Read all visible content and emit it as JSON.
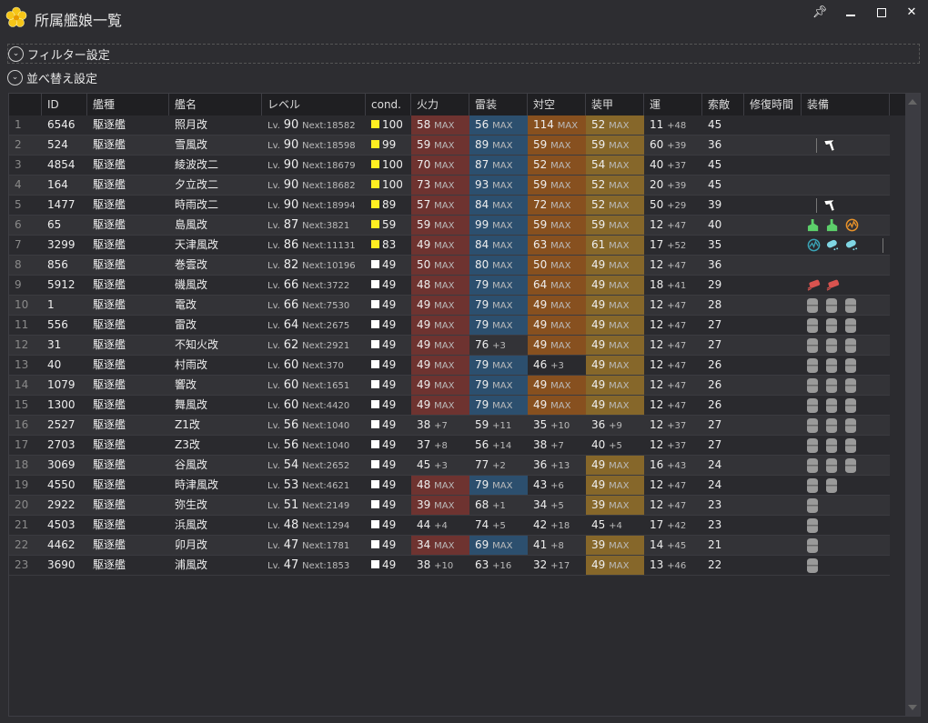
{
  "window": {
    "title": "所属艦娘一覧",
    "pin": "pin-icon",
    "minimize": "minimize-icon",
    "maximize": "maximize-icon",
    "close": "close-icon"
  },
  "filter_label": "フィルター設定",
  "sort_label": "並べ替え設定",
  "columns": [
    "",
    "ID",
    "艦種",
    "艦名",
    "レベル",
    "cond.",
    "火力",
    "雷装",
    "対空",
    "装甲",
    "運",
    "索敵",
    "修復時間",
    "装備"
  ],
  "colors": {
    "fire": "#6e3330",
    "torpedo": "#2c4f6e",
    "aa": "#87501f",
    "armor": "#86672a",
    "cond_high": "#ffee22",
    "cond_normal": "#ffffff"
  },
  "rows": [
    {
      "n": "1",
      "id": "6546",
      "type": "駆逐艦",
      "name": "照月改",
      "lv": "90",
      "next": "Next:18582",
      "cond": "100",
      "fire": [
        "58",
        "MAX"
      ],
      "torp": [
        "56",
        "MAX"
      ],
      "aa": [
        "114",
        "MAX"
      ],
      "arm": [
        "52",
        "MAX"
      ],
      "luck": [
        "11",
        "+48"
      ],
      "los": "45",
      "eq": []
    },
    {
      "n": "2",
      "id": "524",
      "type": "駆逐艦",
      "name": "雪風改",
      "lv": "90",
      "next": "Next:18598",
      "cond": "99",
      "fire": [
        "59",
        "MAX"
      ],
      "torp": [
        "89",
        "MAX"
      ],
      "aa": [
        "59",
        "MAX"
      ],
      "arm": [
        "59",
        "MAX"
      ],
      "luck": [
        "60",
        "+39"
      ],
      "los": "36",
      "eq": [
        "divider",
        "aircraft"
      ]
    },
    {
      "n": "3",
      "id": "4854",
      "type": "駆逐艦",
      "name": "綾波改二",
      "lv": "90",
      "next": "Next:18679",
      "cond": "100",
      "fire": [
        "70",
        "MAX"
      ],
      "torp": [
        "87",
        "MAX"
      ],
      "aa": [
        "52",
        "MAX"
      ],
      "arm": [
        "54",
        "MAX"
      ],
      "luck": [
        "40",
        "+37"
      ],
      "los": "45",
      "eq": []
    },
    {
      "n": "4",
      "id": "164",
      "type": "駆逐艦",
      "name": "夕立改二",
      "lv": "90",
      "next": "Next:18682",
      "cond": "100",
      "fire": [
        "73",
        "MAX"
      ],
      "torp": [
        "93",
        "MAX"
      ],
      "aa": [
        "59",
        "MAX"
      ],
      "arm": [
        "52",
        "MAX"
      ],
      "luck": [
        "20",
        "+39"
      ],
      "los": "45",
      "eq": []
    },
    {
      "n": "5",
      "id": "1477",
      "type": "駆逐艦",
      "name": "時雨改二",
      "lv": "90",
      "next": "Next:18994",
      "cond": "89",
      "fire": [
        "57",
        "MAX"
      ],
      "torp": [
        "84",
        "MAX"
      ],
      "aa": [
        "72",
        "MAX"
      ],
      "arm": [
        "52",
        "MAX"
      ],
      "luck": [
        "50",
        "+29"
      ],
      "los": "39",
      "eq": [
        "divider",
        "aircraft"
      ]
    },
    {
      "n": "6",
      "id": "65",
      "type": "駆逐艦",
      "name": "島風改",
      "lv": "87",
      "next": "Next:3821",
      "cond": "59",
      "fire": [
        "59",
        "MAX"
      ],
      "torp": [
        "99",
        "MAX"
      ],
      "aa": [
        "59",
        "MAX"
      ],
      "arm": [
        "59",
        "MAX"
      ],
      "luck": [
        "12",
        "+47"
      ],
      "los": "40",
      "eq": [
        "gun",
        "gun",
        "radar-orange"
      ]
    },
    {
      "n": "7",
      "id": "3299",
      "type": "駆逐艦",
      "name": "天津風改",
      "lv": "86",
      "next": "Next:11131",
      "cond": "83",
      "fire": [
        "49",
        "MAX"
      ],
      "torp": [
        "84",
        "MAX"
      ],
      "aa": [
        "63",
        "MAX"
      ],
      "arm": [
        "61",
        "MAX"
      ],
      "luck": [
        "17",
        "+52"
      ],
      "los": "35",
      "eq": [
        "radar-teal",
        "depth-charge",
        "depth-charge",
        "divider"
      ]
    },
    {
      "n": "8",
      "id": "856",
      "type": "駆逐艦",
      "name": "巻雲改",
      "lv": "82",
      "next": "Next:10196",
      "cond": "49",
      "fire": [
        "50",
        "MAX"
      ],
      "torp": [
        "80",
        "MAX"
      ],
      "aa": [
        "50",
        "MAX"
      ],
      "arm": [
        "49",
        "MAX"
      ],
      "luck": [
        "12",
        "+47"
      ],
      "los": "36",
      "eq": []
    },
    {
      "n": "9",
      "id": "5912",
      "type": "駆逐艦",
      "name": "磯風改",
      "lv": "66",
      "next": "Next:3722",
      "cond": "49",
      "fire": [
        "48",
        "MAX"
      ],
      "torp": [
        "79",
        "MAX"
      ],
      "aa": [
        "64",
        "MAX"
      ],
      "arm": [
        "49",
        "MAX"
      ],
      "luck": [
        "18",
        "+41"
      ],
      "los": "29",
      "eq": [
        "torpedo",
        "torpedo"
      ]
    },
    {
      "n": "10",
      "id": "1",
      "type": "駆逐艦",
      "name": "電改",
      "lv": "66",
      "next": "Next:7530",
      "cond": "49",
      "fire": [
        "49",
        "MAX"
      ],
      "torp": [
        "79",
        "MAX"
      ],
      "aa": [
        "49",
        "MAX"
      ],
      "arm": [
        "49",
        "MAX"
      ],
      "luck": [
        "12",
        "+47"
      ],
      "los": "28",
      "eq": [
        "drum",
        "drum",
        "drum"
      ]
    },
    {
      "n": "11",
      "id": "556",
      "type": "駆逐艦",
      "name": "雷改",
      "lv": "64",
      "next": "Next:2675",
      "cond": "49",
      "fire": [
        "49",
        "MAX"
      ],
      "torp": [
        "79",
        "MAX"
      ],
      "aa": [
        "49",
        "MAX"
      ],
      "arm": [
        "49",
        "MAX"
      ],
      "luck": [
        "12",
        "+47"
      ],
      "los": "27",
      "eq": [
        "drum",
        "drum",
        "drum"
      ]
    },
    {
      "n": "12",
      "id": "31",
      "type": "駆逐艦",
      "name": "不知火改",
      "lv": "62",
      "next": "Next:2921",
      "cond": "49",
      "fire": [
        "49",
        "MAX"
      ],
      "torp": [
        "76",
        "+3"
      ],
      "aa": [
        "49",
        "MAX"
      ],
      "arm": [
        "49",
        "MAX"
      ],
      "luck": [
        "12",
        "+47"
      ],
      "los": "27",
      "eq": [
        "drum",
        "drum",
        "drum"
      ]
    },
    {
      "n": "13",
      "id": "40",
      "type": "駆逐艦",
      "name": "村雨改",
      "lv": "60",
      "next": "Next:370",
      "cond": "49",
      "fire": [
        "49",
        "MAX"
      ],
      "torp": [
        "79",
        "MAX"
      ],
      "aa": [
        "46",
        "+3"
      ],
      "arm": [
        "49",
        "MAX"
      ],
      "luck": [
        "12",
        "+47"
      ],
      "los": "26",
      "eq": [
        "drum",
        "drum",
        "drum"
      ]
    },
    {
      "n": "14",
      "id": "1079",
      "type": "駆逐艦",
      "name": "響改",
      "lv": "60",
      "next": "Next:1651",
      "cond": "49",
      "fire": [
        "49",
        "MAX"
      ],
      "torp": [
        "79",
        "MAX"
      ],
      "aa": [
        "49",
        "MAX"
      ],
      "arm": [
        "49",
        "MAX"
      ],
      "luck": [
        "12",
        "+47"
      ],
      "los": "26",
      "eq": [
        "drum",
        "drum",
        "drum"
      ]
    },
    {
      "n": "15",
      "id": "1300",
      "type": "駆逐艦",
      "name": "舞風改",
      "lv": "60",
      "next": "Next:4420",
      "cond": "49",
      "fire": [
        "49",
        "MAX"
      ],
      "torp": [
        "79",
        "MAX"
      ],
      "aa": [
        "49",
        "MAX"
      ],
      "arm": [
        "49",
        "MAX"
      ],
      "luck": [
        "12",
        "+47"
      ],
      "los": "26",
      "eq": [
        "drum",
        "drum",
        "drum"
      ]
    },
    {
      "n": "16",
      "id": "2527",
      "type": "駆逐艦",
      "name": "Z1改",
      "lv": "56",
      "next": "Next:1040",
      "cond": "49",
      "fire": [
        "38",
        "+7"
      ],
      "torp": [
        "59",
        "+11"
      ],
      "aa": [
        "35",
        "+10"
      ],
      "arm": [
        "36",
        "+9"
      ],
      "luck": [
        "12",
        "+37"
      ],
      "los": "27",
      "eq": [
        "drum",
        "drum",
        "drum"
      ]
    },
    {
      "n": "17",
      "id": "2703",
      "type": "駆逐艦",
      "name": "Z3改",
      "lv": "56",
      "next": "Next:1040",
      "cond": "49",
      "fire": [
        "37",
        "+8"
      ],
      "torp": [
        "56",
        "+14"
      ],
      "aa": [
        "38",
        "+7"
      ],
      "arm": [
        "40",
        "+5"
      ],
      "luck": [
        "12",
        "+37"
      ],
      "los": "27",
      "eq": [
        "drum",
        "drum",
        "drum"
      ]
    },
    {
      "n": "18",
      "id": "3069",
      "type": "駆逐艦",
      "name": "谷風改",
      "lv": "54",
      "next": "Next:2652",
      "cond": "49",
      "fire": [
        "45",
        "+3"
      ],
      "torp": [
        "77",
        "+2"
      ],
      "aa": [
        "36",
        "+13"
      ],
      "arm": [
        "49",
        "MAX"
      ],
      "luck": [
        "16",
        "+43"
      ],
      "los": "24",
      "eq": [
        "drum",
        "drum",
        "drum"
      ]
    },
    {
      "n": "19",
      "id": "4550",
      "type": "駆逐艦",
      "name": "時津風改",
      "lv": "53",
      "next": "Next:4621",
      "cond": "49",
      "fire": [
        "48",
        "MAX"
      ],
      "torp": [
        "79",
        "MAX"
      ],
      "aa": [
        "43",
        "+6"
      ],
      "arm": [
        "49",
        "MAX"
      ],
      "luck": [
        "12",
        "+47"
      ],
      "los": "24",
      "eq": [
        "drum",
        "drum"
      ]
    },
    {
      "n": "20",
      "id": "2922",
      "type": "駆逐艦",
      "name": "弥生改",
      "lv": "51",
      "next": "Next:2149",
      "cond": "49",
      "fire": [
        "39",
        "MAX"
      ],
      "torp": [
        "68",
        "+1"
      ],
      "aa": [
        "34",
        "+5"
      ],
      "arm": [
        "39",
        "MAX"
      ],
      "luck": [
        "12",
        "+47"
      ],
      "los": "23",
      "eq": [
        "drum"
      ]
    },
    {
      "n": "21",
      "id": "4503",
      "type": "駆逐艦",
      "name": "浜風改",
      "lv": "48",
      "next": "Next:1294",
      "cond": "49",
      "fire": [
        "44",
        "+4"
      ],
      "torp": [
        "74",
        "+5"
      ],
      "aa": [
        "42",
        "+18"
      ],
      "arm": [
        "45",
        "+4"
      ],
      "luck": [
        "17",
        "+42"
      ],
      "los": "23",
      "eq": [
        "drum"
      ]
    },
    {
      "n": "22",
      "id": "4462",
      "type": "駆逐艦",
      "name": "卯月改",
      "lv": "47",
      "next": "Next:1781",
      "cond": "49",
      "fire": [
        "34",
        "MAX"
      ],
      "torp": [
        "69",
        "MAX"
      ],
      "aa": [
        "41",
        "+8"
      ],
      "arm": [
        "39",
        "MAX"
      ],
      "luck": [
        "14",
        "+45"
      ],
      "los": "21",
      "eq": [
        "drum"
      ]
    },
    {
      "n": "23",
      "id": "3690",
      "type": "駆逐艦",
      "name": "浦風改",
      "lv": "47",
      "next": "Next:1853",
      "cond": "49",
      "fire": [
        "38",
        "+10"
      ],
      "torp": [
        "63",
        "+16"
      ],
      "aa": [
        "32",
        "+17"
      ],
      "arm": [
        "49",
        "MAX"
      ],
      "luck": [
        "13",
        "+46"
      ],
      "los": "22",
      "eq": [
        "drum"
      ]
    }
  ],
  "lv_prefix": "Lv."
}
